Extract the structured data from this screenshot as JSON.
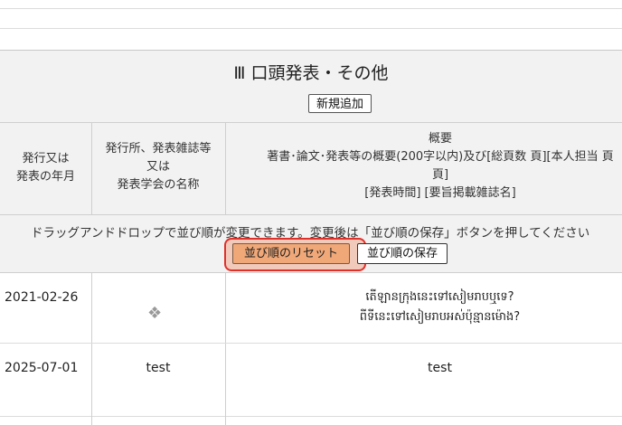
{
  "section": {
    "title": "Ⅲ 口頭発表・その他",
    "add_button": "新規追加"
  },
  "columns": {
    "date_header": [
      "発行又は",
      "発表の年月"
    ],
    "publisher_header": [
      "発行所、発表雑誌等",
      "又は",
      "発表学会の名称"
    ],
    "summary_header": [
      "概要",
      "著書･論文･発表等の概要(200字以内)及び[総頁数 頁][本人担当 頁",
      "頁]",
      "[発表時間] [要旨掲載雑誌名]"
    ]
  },
  "dnd": {
    "instructions": "ドラッグアンドドロップで並び順が変更できます。変更後は「並び順の保存」ボタンを押してください",
    "reset_button": "並び順のリセット",
    "save_button": "並び順の保存"
  },
  "rows": [
    {
      "date": "2021-02-26",
      "publisher": "",
      "summary_lines": [
        "តើឡានក្រុងនេះទៅសៀមរាបឬទេ?",
        "ពីទីនេះទៅសៀមរាបអស់ប៉ុន្មានម៉ោង?"
      ]
    },
    {
      "date": "2025-07-01",
      "publisher": "test",
      "summary_lines": [
        "test"
      ]
    }
  ],
  "icons": {
    "drag": "move-handle-icon"
  }
}
